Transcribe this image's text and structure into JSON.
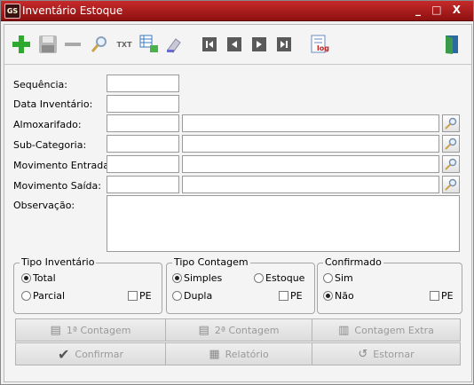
{
  "window": {
    "title": "Inventário Estoque",
    "logo_text": "GS",
    "controls": "_ □ X"
  },
  "toolbar": {
    "icons": [
      "add-icon",
      "save-icon",
      "remove-icon",
      "search-icon",
      "txt-export-icon",
      "export-grid-icon",
      "clear-icon",
      "first-record-icon",
      "previous-record-icon",
      "next-record-icon",
      "last-record-icon",
      "log-icon",
      "exit-door-icon"
    ],
    "txt_label": "TXT",
    "log_label": "log"
  },
  "form": {
    "sequencia": {
      "label": "Sequência:",
      "value": ""
    },
    "data_inventario": {
      "label": "Data Inventário:",
      "value": ""
    },
    "almoxarifado": {
      "label": "Almoxarifado:",
      "code": "",
      "description": ""
    },
    "sub_categoria": {
      "label": "Sub-Categoria:",
      "code": "",
      "description": ""
    },
    "movimento_entrada": {
      "label": "Movimento Entrada:",
      "code": "",
      "description": ""
    },
    "movimento_saida": {
      "label": "Movimento Saída:",
      "code": "",
      "description": ""
    },
    "observacao": {
      "label": "Observação:",
      "value": ""
    }
  },
  "groups": {
    "tipo_inventario": {
      "legend": "Tipo Inventário",
      "opt1": "Total",
      "opt2": "Parcial",
      "check": "PE",
      "selected": "Total"
    },
    "tipo_contagem": {
      "legend": "Tipo Contagem",
      "opt1": "Simples",
      "opt2": "Estoque",
      "opt3": "Dupla",
      "check": "PE",
      "selected": "Simples"
    },
    "confirmado": {
      "legend": "Confirmado",
      "opt1": "Sim",
      "opt2": "Não",
      "check": "PE",
      "selected": "Não"
    }
  },
  "buttons": {
    "contagem1": "1ª Contagem",
    "contagem2": "2ª Contagem",
    "contagem_extra": "Contagem Extra",
    "confirmar": "Confirmar",
    "relatorio": "Relatório",
    "estornar": "Estornar"
  },
  "colors": {
    "title_bar": "#b01c1c",
    "add_green": "#2fa82f",
    "nav_gray": "#555555"
  }
}
